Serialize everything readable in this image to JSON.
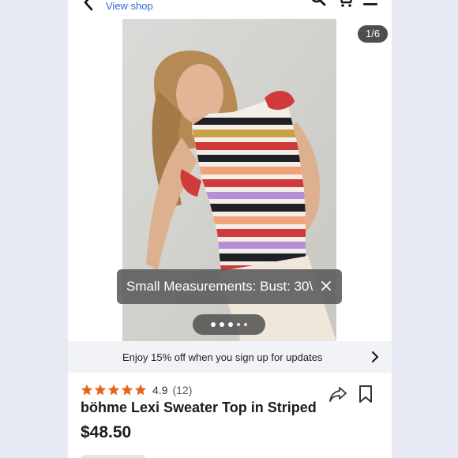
{
  "header": {
    "back_icon": "chevron-left-icon",
    "view_shop_label": "View shop",
    "icons": [
      "search-icon",
      "cart-icon",
      "menu-icon"
    ]
  },
  "gallery": {
    "counter": "1/6",
    "current_image": 1,
    "total_images": 6,
    "tooltip_text": "Small Measurements: Bust: 30\\",
    "tooltip_close_icon": "close-icon",
    "dot_count": 5,
    "active_dot": 1
  },
  "promo": {
    "text": "Enjoy 15% off when you sign up for updates",
    "chevron_icon": "chevron-right-icon"
  },
  "product": {
    "rating": "4.9",
    "rating_count": "(12)",
    "stars": 5,
    "star_color": "#e8641b",
    "title": "böhme Lexi Sweater Top in Striped",
    "price": "$48.50",
    "share_icon": "share-icon",
    "bookmark_icon": "bookmark-icon"
  }
}
